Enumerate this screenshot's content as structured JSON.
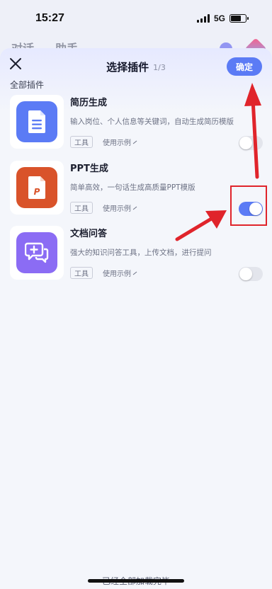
{
  "status_bar": {
    "time": "15:27",
    "network": "5G"
  },
  "background_app": {
    "tabs": [
      "对话",
      "助手"
    ]
  },
  "sheet": {
    "title": "选择插件",
    "page_indicator": "1/3",
    "confirm_label": "确定",
    "section_label": "全部插件"
  },
  "plugins": [
    {
      "name": "简历生成",
      "description": "输入岗位、个人信息等关键词，自动生成简历模版",
      "tag": "工具",
      "example_label": "使用示例",
      "enabled": false,
      "icon": "document-icon",
      "color": "#5b7bf5"
    },
    {
      "name": "PPT生成",
      "description": "简单高效，一句话生成高质量PPT模版",
      "tag": "工具",
      "example_label": "使用示例",
      "enabled": true,
      "icon": "ppt-file-icon",
      "color": "#d9532a"
    },
    {
      "name": "文档问答",
      "description": "强大的知识问答工具，上传文档，进行提问",
      "tag": "工具",
      "example_label": "使用示例",
      "enabled": false,
      "icon": "chat-plus-icon",
      "color": "#8b6cf4"
    }
  ],
  "footer": {
    "text": "已经全部加载完毕"
  },
  "colors": {
    "accent": "#5b7bf5",
    "annotation": "#e0242b"
  }
}
